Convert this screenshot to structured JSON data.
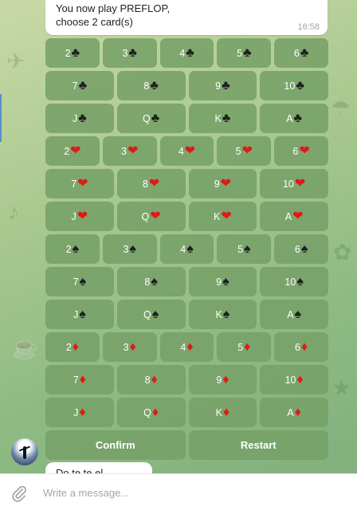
{
  "message": {
    "text": "You now play PREFLOP,\nchoose 2 card(s)",
    "time": "16:58"
  },
  "keyboard": {
    "rows": [
      [
        {
          "rank": "2",
          "suit": "♣",
          "color": "black"
        },
        {
          "rank": "3",
          "suit": "♣",
          "color": "black"
        },
        {
          "rank": "4",
          "suit": "♣",
          "color": "black"
        },
        {
          "rank": "5",
          "suit": "♣",
          "color": "black"
        },
        {
          "rank": "6",
          "suit": "♣",
          "color": "black"
        }
      ],
      [
        {
          "rank": "7",
          "suit": "♣",
          "color": "black"
        },
        {
          "rank": "8",
          "suit": "♣",
          "color": "black"
        },
        {
          "rank": "9",
          "suit": "♣",
          "color": "black"
        },
        {
          "rank": "10",
          "suit": "♣",
          "color": "black"
        }
      ],
      [
        {
          "rank": "J",
          "suit": "♣",
          "color": "black"
        },
        {
          "rank": "Q",
          "suit": "♣",
          "color": "black"
        },
        {
          "rank": "K",
          "suit": "♣",
          "color": "black"
        },
        {
          "rank": "A",
          "suit": "♣",
          "color": "black"
        }
      ],
      [
        {
          "rank": "2",
          "suit": "❤",
          "color": "red"
        },
        {
          "rank": "3",
          "suit": "❤",
          "color": "red"
        },
        {
          "rank": "4",
          "suit": "❤",
          "color": "red"
        },
        {
          "rank": "5",
          "suit": "❤",
          "color": "red"
        },
        {
          "rank": "6",
          "suit": "❤",
          "color": "red"
        }
      ],
      [
        {
          "rank": "7",
          "suit": "❤",
          "color": "red"
        },
        {
          "rank": "8",
          "suit": "❤",
          "color": "red"
        },
        {
          "rank": "9",
          "suit": "❤",
          "color": "red"
        },
        {
          "rank": "10",
          "suit": "❤",
          "color": "red"
        }
      ],
      [
        {
          "rank": "J",
          "suit": "❤",
          "color": "red"
        },
        {
          "rank": "Q",
          "suit": "❤",
          "color": "red"
        },
        {
          "rank": "K",
          "suit": "❤",
          "color": "red"
        },
        {
          "rank": "A",
          "suit": "❤",
          "color": "red"
        }
      ],
      [
        {
          "rank": "2",
          "suit": "♠",
          "color": "black"
        },
        {
          "rank": "3",
          "suit": "♠",
          "color": "black"
        },
        {
          "rank": "4",
          "suit": "♠",
          "color": "black"
        },
        {
          "rank": "5",
          "suit": "♠",
          "color": "black"
        },
        {
          "rank": "6",
          "suit": "♠",
          "color": "black"
        }
      ],
      [
        {
          "rank": "7",
          "suit": "♠",
          "color": "black"
        },
        {
          "rank": "8",
          "suit": "♠",
          "color": "black"
        },
        {
          "rank": "9",
          "suit": "♠",
          "color": "black"
        },
        {
          "rank": "10",
          "suit": "♠",
          "color": "black"
        }
      ],
      [
        {
          "rank": "J",
          "suit": "♠",
          "color": "black"
        },
        {
          "rank": "Q",
          "suit": "♠",
          "color": "black"
        },
        {
          "rank": "K",
          "suit": "♠",
          "color": "black"
        },
        {
          "rank": "A",
          "suit": "♠",
          "color": "black"
        }
      ],
      [
        {
          "rank": "2",
          "suit": "♦",
          "color": "red"
        },
        {
          "rank": "3",
          "suit": "♦",
          "color": "red"
        },
        {
          "rank": "4",
          "suit": "♦",
          "color": "red"
        },
        {
          "rank": "5",
          "suit": "♦",
          "color": "red"
        },
        {
          "rank": "6",
          "suit": "♦",
          "color": "red"
        }
      ],
      [
        {
          "rank": "7",
          "suit": "♦",
          "color": "red"
        },
        {
          "rank": "8",
          "suit": "♦",
          "color": "red"
        },
        {
          "rank": "9",
          "suit": "♦",
          "color": "red"
        },
        {
          "rank": "10",
          "suit": "♦",
          "color": "red"
        }
      ],
      [
        {
          "rank": "J",
          "suit": "♦",
          "color": "red"
        },
        {
          "rank": "Q",
          "suit": "♦",
          "color": "red"
        },
        {
          "rank": "K",
          "suit": "♦",
          "color": "red"
        },
        {
          "rank": "A",
          "suit": "♦",
          "color": "red"
        }
      ]
    ],
    "actions": {
      "confirm": "Confirm",
      "restart": "Restart"
    }
  },
  "next_message": {
    "text": "Do te te el..."
  },
  "input": {
    "placeholder": "Write a message..."
  },
  "icons": {
    "attach": "paperclip-icon",
    "avatar": "bot-avatar"
  },
  "colors": {
    "key_bg": "#76a068",
    "red_suit": "#e01919",
    "black_suit": "#1e1e1e"
  }
}
